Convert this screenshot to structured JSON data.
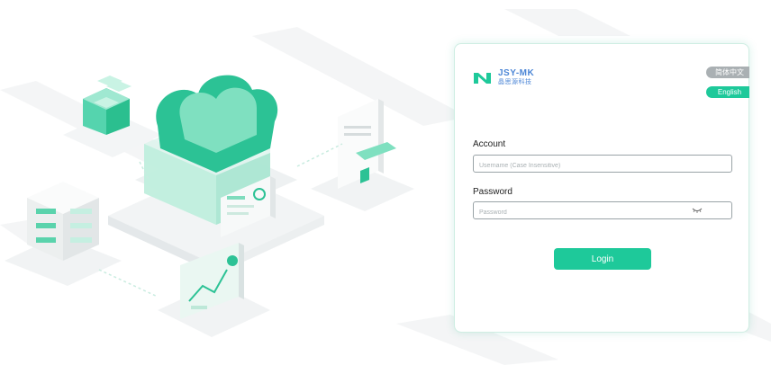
{
  "brand": {
    "name_en": "JSY-MK",
    "name_cn": "晶思源科技",
    "logo_icon": "jsymk-logo",
    "accent_color": "#1ec99a",
    "brand_blue": "#4c86d6"
  },
  "language": {
    "options": [
      "简体中文",
      "English"
    ],
    "selected": "English"
  },
  "form": {
    "account_label": "Account",
    "account_placeholder": "Username (Case Insensitive)",
    "account_value": "",
    "password_label": "Password",
    "password_placeholder": "Password",
    "password_value": "",
    "password_visibility_icon": "eye-closed-icon",
    "login_label": "Login"
  }
}
